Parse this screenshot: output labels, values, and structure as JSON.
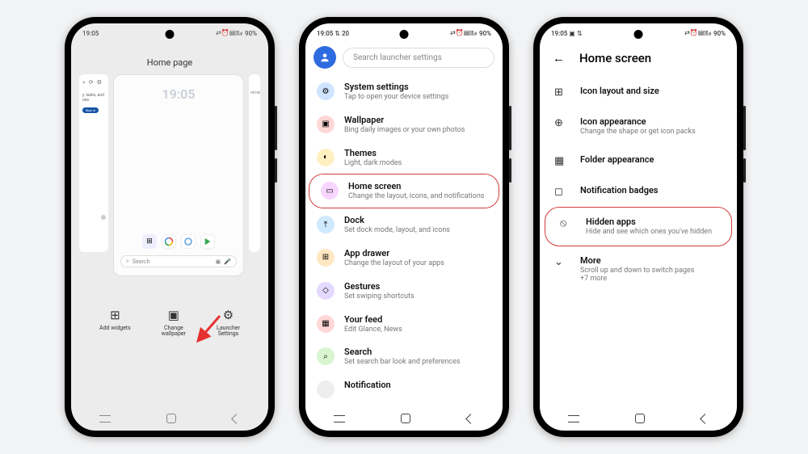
{
  "status": {
    "time": "19:05",
    "battery_pct": "90%",
    "indicators": "⇄ ⏰ ▤ ⫾ ⫾ ₐₗₗ"
  },
  "phone1": {
    "title": "Home page",
    "edge_text": "y, tasks, and\noes",
    "signin": "Sign in",
    "edge_right": "rements",
    "preview_time": "19:05",
    "preview_date": "",
    "search_placeholder": "Search",
    "apps": [
      "grid",
      "google",
      "swirl",
      "play"
    ],
    "actions": [
      {
        "icon": "⊞",
        "label": "Add widgets"
      },
      {
        "icon": "▣",
        "label": "Change\nwallpaper"
      },
      {
        "icon": "⚙",
        "label": "Launcher\nSettings"
      }
    ]
  },
  "phone2": {
    "search_placeholder": "Search launcher settings",
    "items": [
      {
        "color": "#cfe4ff",
        "glyph": "⚙",
        "title": "System settings",
        "sub": "Tap to open your device settings"
      },
      {
        "color": "#ffd7d7",
        "glyph": "▣",
        "title": "Wallpaper",
        "sub": "Bing daily images or your own photos"
      },
      {
        "color": "#fff0c2",
        "glyph": "◐",
        "title": "Themes",
        "sub": "Light, dark modes"
      },
      {
        "color": "#f7d6ff",
        "glyph": "▭",
        "title": "Home screen",
        "sub": "Change the layout, icons, and notifications",
        "highlighted": true
      },
      {
        "color": "#cfe9ff",
        "glyph": "⤒",
        "title": "Dock",
        "sub": "Set dock mode, layout, and icons"
      },
      {
        "color": "#ffe7c2",
        "glyph": "⊞",
        "title": "App drawer",
        "sub": "Change the layout of your apps"
      },
      {
        "color": "#e4d9ff",
        "glyph": "◇",
        "title": "Gestures",
        "sub": "Set swiping shortcuts"
      },
      {
        "color": "#ffd7d7",
        "glyph": "▦",
        "title": "Your feed",
        "sub": "Edit Glance, News"
      },
      {
        "color": "#d8f5d0",
        "glyph": "⌕",
        "title": "Search",
        "sub": "Set search bar look and preferences"
      },
      {
        "color": "#eee",
        "glyph": "",
        "title": "Notification",
        "sub": ""
      }
    ]
  },
  "phone3": {
    "title": "Home screen",
    "items": [
      {
        "glyph": "⊞",
        "title": "Icon layout and size",
        "sub": ""
      },
      {
        "glyph": "⊕",
        "title": "Icon appearance",
        "sub": "Change the shape or get icon packs"
      },
      {
        "glyph": "▦",
        "title": "Folder appearance",
        "sub": ""
      },
      {
        "glyph": "◻",
        "title": "Notification badges",
        "sub": ""
      },
      {
        "glyph": "⦸",
        "title": "Hidden apps",
        "sub": "Hide and see which ones you've hidden",
        "highlighted": true
      },
      {
        "glyph": "⌄",
        "title": "More",
        "sub": "Scroll up and down to switch pages\n+7 more"
      }
    ]
  }
}
